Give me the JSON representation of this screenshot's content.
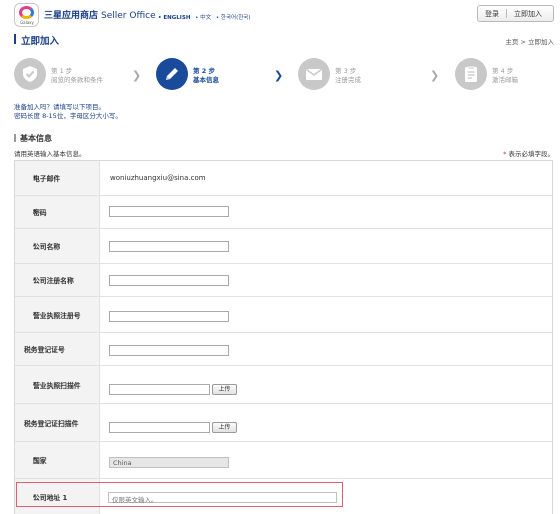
{
  "header": {
    "logo_caption": "Galaxy",
    "brand": "三星应用商店",
    "brand_sub": "Seller Office",
    "languages": [
      "• ENGLISH",
      "• 中文",
      "• 한국어(한국)"
    ],
    "login": "登录",
    "signup": "立即加入"
  },
  "page": {
    "title": "立即加入",
    "breadcrumb": "主页 > 立即加入"
  },
  "steps": [
    {
      "num": "第 1 步",
      "label": "阅览的条款和条件",
      "icon": "shield-check-icon"
    },
    {
      "num": "第 2 步",
      "label": "基本信息",
      "icon": "pencil-icon"
    },
    {
      "num": "第 3 步",
      "label": "注册完成",
      "icon": "envelope-icon"
    },
    {
      "num": "第 4 步",
      "label": "激活邮箱",
      "icon": "clipboard-icon"
    }
  ],
  "notes": {
    "line1": "准备加入吗？请填写以下项目。",
    "line2": "密码长度 8-15位，字母区分大小写。"
  },
  "section": {
    "title": "基本信息",
    "hint": "请用英语输入基本信息。",
    "required_note": "表示必填字段。",
    "required_star": "*"
  },
  "form": {
    "email_label": "电子邮件",
    "email_value": "woniuzhuangxiu@sina.com",
    "password_label": "密码",
    "company_label": "公司名称",
    "company_reg_label": "公司注册名称",
    "license_no_label": "营业执照注册号",
    "tax_no_label": "税务登记证号",
    "license_scan_label": "营业执照扫描件",
    "tax_scan_label": "税务登记证扫描件",
    "upload_label": "上传",
    "country_label": "国家",
    "country_value": "China",
    "address1_label": "公司地址 1",
    "address1_placeholder": "仅限英文输入。"
  },
  "colors": {
    "primary": "#1a4a9a",
    "required": "#c0392b",
    "highlight_border": "#e06070"
  }
}
